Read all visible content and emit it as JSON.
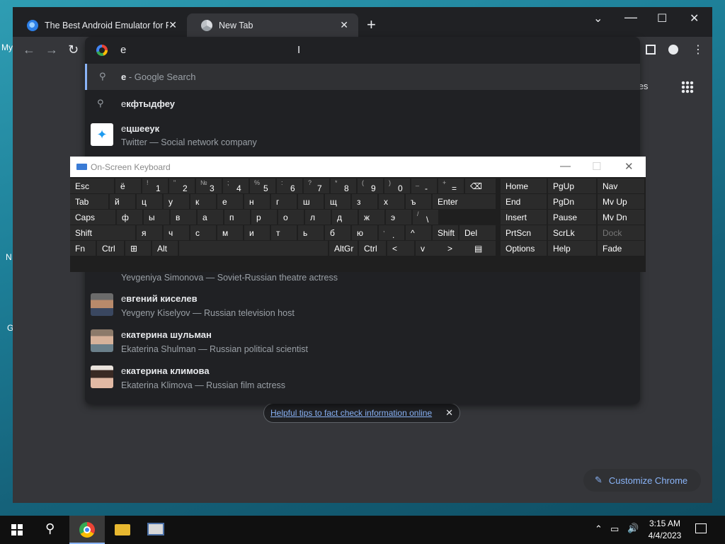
{
  "desktop": {
    "labels": [
      "My",
      "N",
      "G"
    ]
  },
  "tabs": [
    {
      "title": "The Best Android Emulator for PC",
      "close": "✕"
    },
    {
      "title": "New Tab",
      "close": "✕"
    }
  ],
  "new_tab_button": "+",
  "window_controls": {
    "minimize": "⌄",
    "maximize": "☐",
    "close": "✕"
  },
  "nav": {
    "back": "←",
    "forward": "→",
    "reload": "↻"
  },
  "omnibox": {
    "value": "e",
    "suggestions": [
      {
        "bold": "e",
        "rest": " - Google Search",
        "icon": "search-icon"
      },
      {
        "bold_prefix": "е",
        "bold": "кфтыдфеу",
        "icon": "search-icon"
      },
      {
        "prefix": "е",
        "bold": "цшееук",
        "sub": "Twitter — Social network company",
        "icon": "twitter-icon"
      },
      {
        "sub": "Yevgeniya Simonova — Soviet-Russian theatre actress"
      },
      {
        "prefix": "е",
        "bold": "вгений киселев",
        "sub": "Yevgeny Kiselyov — Russian television host"
      },
      {
        "prefix": "е",
        "bold": "катерина шульман",
        "sub": "Ekaterina Shulman — Russian political scientist"
      },
      {
        "prefix": "е",
        "bold": "катерина климова",
        "sub": "Ekaterina Klimova — Russian film actress"
      }
    ]
  },
  "page": {
    "images_link": "nages",
    "tips_link": "Helpful tips to fact check information online",
    "tips_close": "✕",
    "customize": "Customize Chrome"
  },
  "osk": {
    "title": "On-Screen Keyboard",
    "controls": {
      "minimize": "—",
      "maximize": "☐",
      "close": "✕"
    },
    "rows": [
      [
        {
          "l": "Esc"
        },
        {
          "l": "ё"
        },
        {
          "s": "!",
          "b": "1"
        },
        {
          "s": "\"",
          "b": "2"
        },
        {
          "s": "№",
          "b": "3"
        },
        {
          "s": ";",
          "b": "4"
        },
        {
          "s": "%",
          "b": "5"
        },
        {
          "s": ":",
          "b": "6"
        },
        {
          "s": "?",
          "b": "7"
        },
        {
          "s": "*",
          "b": "8"
        },
        {
          "s": "(",
          "b": "9"
        },
        {
          "s": ")",
          "b": "0"
        },
        {
          "s": "_",
          "b": "-"
        },
        {
          "s": "+",
          "b": "="
        },
        {
          "l": "⌫"
        }
      ],
      [
        {
          "l": "Tab"
        },
        {
          "l": "й"
        },
        {
          "l": "ц"
        },
        {
          "l": "у"
        },
        {
          "l": "к"
        },
        {
          "l": "е"
        },
        {
          "l": "н"
        },
        {
          "l": "г"
        },
        {
          "l": "ш"
        },
        {
          "l": "щ"
        },
        {
          "l": "з"
        },
        {
          "l": "х"
        },
        {
          "l": "ъ"
        },
        {
          "l": "Enter"
        }
      ],
      [
        {
          "l": "Caps"
        },
        {
          "l": "ф"
        },
        {
          "l": "ы"
        },
        {
          "l": "в"
        },
        {
          "l": "а"
        },
        {
          "l": "п"
        },
        {
          "l": "р"
        },
        {
          "l": "о"
        },
        {
          "l": "л"
        },
        {
          "l": "д"
        },
        {
          "l": "ж"
        },
        {
          "l": "э"
        },
        {
          "s": "/",
          "b": "\\"
        }
      ],
      [
        {
          "l": "Shift"
        },
        {
          "l": "я"
        },
        {
          "l": "ч"
        },
        {
          "l": "с"
        },
        {
          "l": "м"
        },
        {
          "l": "и"
        },
        {
          "l": "т"
        },
        {
          "l": "ь"
        },
        {
          "l": "б"
        },
        {
          "l": "ю"
        },
        {
          "s": ",",
          "b": "."
        },
        {
          "l": "^"
        },
        {
          "l": "Shift"
        },
        {
          "l": "Del"
        }
      ],
      [
        {
          "l": "Fn"
        },
        {
          "l": "Ctrl"
        },
        {
          "l": "⊞"
        },
        {
          "l": "Alt"
        },
        {
          "l": ""
        },
        {
          "l": "AltGr"
        },
        {
          "l": "Ctrl"
        },
        {
          "l": "<"
        },
        {
          "l": "v"
        },
        {
          "l": ">"
        },
        {
          "l": "▤"
        }
      ]
    ],
    "side": [
      [
        "Home",
        "PgUp",
        "Nav"
      ],
      [
        "End",
        "PgDn",
        "Mv Up"
      ],
      [
        "Insert",
        "Pause",
        "Mv Dn"
      ],
      [
        "PrtScn",
        "ScrLk",
        "Dock"
      ],
      [
        "Options",
        "Help",
        "Fade"
      ]
    ]
  },
  "taskbar": {
    "time": "3:15 AM",
    "date": "4/4/2023"
  }
}
